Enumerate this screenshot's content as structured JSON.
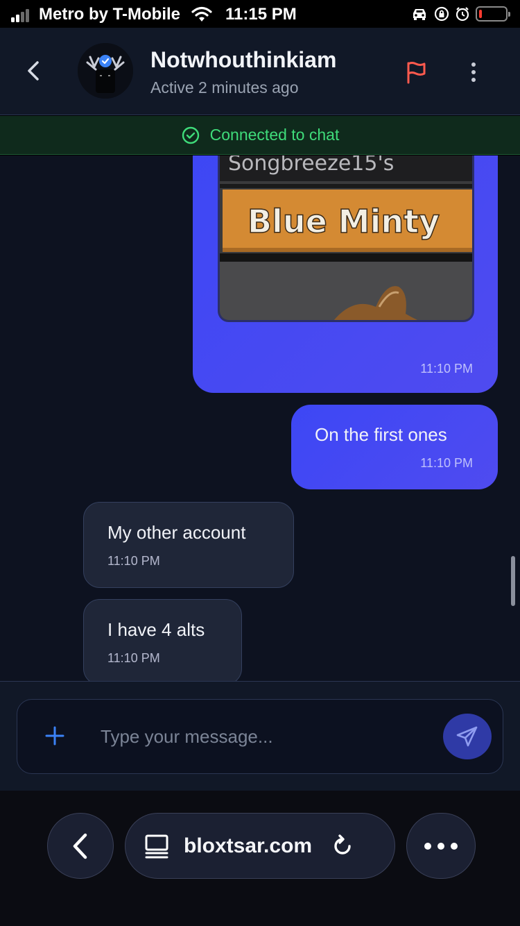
{
  "status_bar": {
    "carrier": "Metro by T-Mobile",
    "time": "11:15 PM"
  },
  "header": {
    "contact_name": "Notwhouthinkiam",
    "contact_status": "Active 2 minutes ago"
  },
  "banner": {
    "text": "Connected to chat",
    "color": "#3fdc7a"
  },
  "messages": [
    {
      "direction": "outgoing",
      "type": "image",
      "image_text": [
        "Songbreeze15's",
        "Blue Minty"
      ],
      "time": "11:10 PM"
    },
    {
      "direction": "outgoing",
      "type": "text",
      "text": "On  the first ones",
      "time": "11:10 PM"
    },
    {
      "direction": "incoming",
      "type": "text",
      "text": "My other account",
      "time": "11:10 PM"
    },
    {
      "direction": "incoming",
      "type": "text",
      "text": "I have 4 alts",
      "time": "11:10 PM"
    }
  ],
  "composer": {
    "placeholder": "Type your message...",
    "value": ""
  },
  "browser": {
    "url": "bloxtsar.com"
  },
  "colors": {
    "outgoing_bubble": "#4349f4",
    "incoming_bubble": "#1f2638",
    "flag": "#ff5a4e",
    "accent_blue": "#3b82f6"
  },
  "icons": [
    "back-icon",
    "verified-icon",
    "flag-icon",
    "more-vertical-icon",
    "check-circle-icon",
    "plus-icon",
    "send-icon",
    "browser-back-icon",
    "tab-icon",
    "reload-icon",
    "more-horizontal-icon"
  ]
}
